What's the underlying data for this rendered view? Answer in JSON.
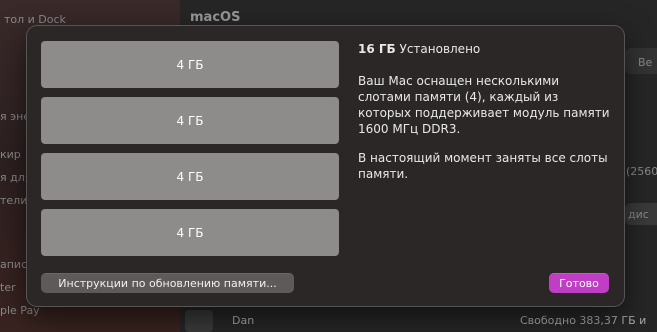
{
  "background": {
    "sidebar_items": [
      "тол и Dock",
      "я энер",
      "кир",
      "я для",
      "тели",
      "апис",
      "ter",
      "ple Pay"
    ],
    "section_title": "macOS",
    "right_fragments": [
      "Ве",
      "(2560",
      "дис",
      "ГБ и"
    ],
    "disk_name": "Dan",
    "disk_free": "Свободно 383,37 ГБ и"
  },
  "memory": {
    "total": "16 ГБ",
    "total_suffix": "Установлено",
    "description": "Ваш Mac оснащен несколькими слотами памяти (4), каждый из которых поддерживает модуль памяти 1600 МГц DDR3.",
    "status": "В настоящий момент заняты все слоты памяти.",
    "slots": [
      "4 ГБ",
      "4 ГБ",
      "4 ГБ",
      "4 ГБ"
    ]
  },
  "buttons": {
    "instructions": "Инструкции по обновлению памяти...",
    "done": "Готово"
  },
  "colors": {
    "accent": "#c03ec5",
    "slot": "#8e8b8b",
    "sheet": "#2b2727"
  }
}
